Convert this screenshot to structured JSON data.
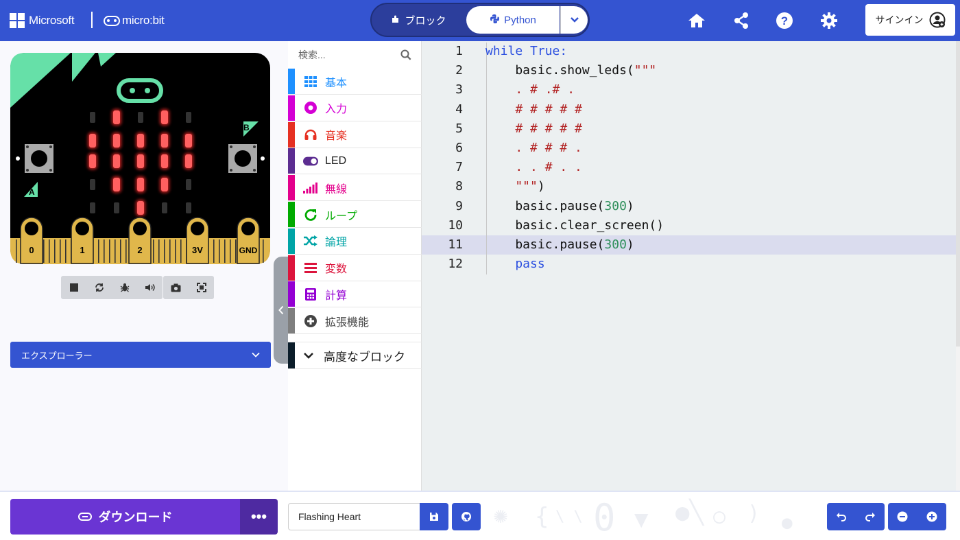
{
  "header": {
    "brand_microsoft": "Microsoft",
    "brand_microbit": "micro:bit",
    "toggle_blocks": "ブロック",
    "toggle_python": "Python",
    "signin": "サインイン",
    "icons": [
      "home-icon",
      "share-icon",
      "help-icon",
      "settings-icon"
    ]
  },
  "simulator": {
    "pins": [
      "0",
      "1",
      "2",
      "3V",
      "GND"
    ],
    "button_a": "A",
    "button_b": "B",
    "led_matrix": [
      [
        0,
        1,
        0,
        1,
        0
      ],
      [
        1,
        1,
        1,
        1,
        1
      ],
      [
        1,
        1,
        1,
        1,
        1
      ],
      [
        0,
        1,
        1,
        1,
        0
      ],
      [
        0,
        0,
        1,
        0,
        0
      ]
    ],
    "toolbar_icons": [
      "stop-icon",
      "restart-icon",
      "debug-icon",
      "sound-icon",
      "screenshot-icon",
      "fullscreen-icon"
    ]
  },
  "explorer": {
    "label": "エクスプローラー"
  },
  "toolbox": {
    "search_placeholder": "検索...",
    "categories": [
      {
        "label": "基本",
        "color": "#1e90ff",
        "icon": "grid-icon"
      },
      {
        "label": "入力",
        "color": "#d400d4",
        "icon": "circle-dot-icon"
      },
      {
        "label": "音楽",
        "color": "#e63022",
        "icon": "headphones-icon"
      },
      {
        "label": "LED",
        "color": "#5c2d91",
        "icon": "toggle-icon"
      },
      {
        "label": "無線",
        "color": "#e3008c",
        "icon": "signal-icon"
      },
      {
        "label": "ループ",
        "color": "#00aa00",
        "icon": "loop-icon"
      },
      {
        "label": "論理",
        "color": "#00a4a6",
        "icon": "shuffle-icon"
      },
      {
        "label": "変数",
        "color": "#dc143c",
        "icon": "list-icon"
      },
      {
        "label": "計算",
        "color": "#9400d3",
        "icon": "calculator-icon"
      },
      {
        "label": "拡張機能",
        "color": "#7f7f7f",
        "icon": "plus-circle-icon"
      }
    ],
    "advanced": "高度なブロック"
  },
  "code": {
    "line_numbers": [
      "1",
      "2",
      "3",
      "4",
      "5",
      "6",
      "7",
      "8",
      "9",
      "10",
      "11",
      "12"
    ],
    "lines": [
      [
        [
          "while True:",
          "kw"
        ]
      ],
      [
        [
          "    basic.show_leds(",
          ""
        ],
        [
          "\"\"\"",
          "str"
        ]
      ],
      [
        [
          "    . # .# .",
          "str"
        ]
      ],
      [
        [
          "    # # # # #",
          "str"
        ]
      ],
      [
        [
          "    # # # # #",
          "str"
        ]
      ],
      [
        [
          "    . # # # .",
          "str"
        ]
      ],
      [
        [
          "    . . # . .",
          "str"
        ]
      ],
      [
        [
          "    \"\"\"",
          "str"
        ],
        [
          ")",
          ""
        ]
      ],
      [
        [
          "    basic.pause(",
          ""
        ],
        [
          "300",
          "num"
        ],
        [
          ")",
          ""
        ]
      ],
      [
        [
          "    basic.clear_screen()",
          ""
        ]
      ],
      [
        [
          "    basic.pause(",
          ""
        ],
        [
          "300",
          "num"
        ],
        [
          ")",
          ""
        ]
      ],
      [
        [
          "    pass",
          "kw"
        ]
      ]
    ],
    "highlighted_line": 11
  },
  "bottom": {
    "download": "ダウンロード",
    "more": "•••",
    "project_name": "Flashing Heart"
  }
}
